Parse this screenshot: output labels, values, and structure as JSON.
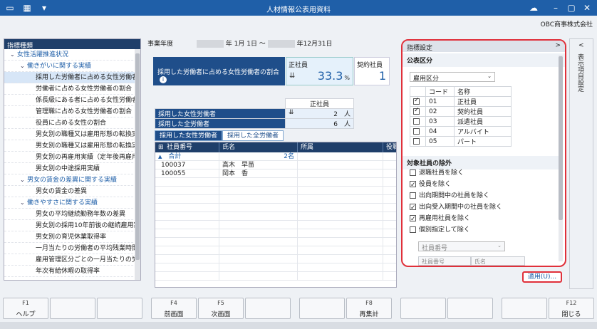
{
  "window": {
    "title": "人材情報公表用資料",
    "company": "OBC商事株式会社"
  },
  "tree": {
    "header": "指標種類",
    "items": [
      {
        "label": "女性活躍推進状況",
        "level": 0
      },
      {
        "label": "働きがいに関する実績",
        "level": 1
      },
      {
        "label": "採用した労働者に占める女性労働者の",
        "level": 2
      },
      {
        "label": "労働者に占める女性労働者の割合",
        "level": 2
      },
      {
        "label": "係長級にある者に占める女性労働者の",
        "level": 2
      },
      {
        "label": "管理職に占める女性労働者の割合",
        "level": 2
      },
      {
        "label": "役員に占める女性の割合",
        "level": 2
      },
      {
        "label": "男女別の職種又は雇用形態の転換実",
        "level": 2
      },
      {
        "label": "男女別の職種又は雇用形態の転換実",
        "level": 2
      },
      {
        "label": "男女別の再雇用実績（定年後再雇用",
        "level": 2
      },
      {
        "label": "男女別の中途採用実績",
        "level": 2
      },
      {
        "label": "男女の賃金の差異に関する実績",
        "level": 1
      },
      {
        "label": "男女の賃金の差異",
        "level": 2
      },
      {
        "label": "働きやすさに関する実績",
        "level": 1
      },
      {
        "label": "男女の平均継続勤務年数の差異",
        "level": 2
      },
      {
        "label": "男女別の採用10年前後の継続雇用割",
        "level": 2
      },
      {
        "label": "男女別の育児休業取得率",
        "level": 2
      },
      {
        "label": "一月当たりの労働者の平均残業時間",
        "level": 2
      },
      {
        "label": "雇用管理区分ごとの一月当たりの労",
        "level": 2
      },
      {
        "label": "年次有給休暇の取得率",
        "level": 2
      }
    ]
  },
  "period": {
    "label": "事業年度",
    "start_suffix": "年 1月 1日 ～",
    "end_suffix": "年12月31日"
  },
  "metric": {
    "title": "採用した労働者に占める女性労働者の割合",
    "info_icon": "i"
  },
  "cards": [
    {
      "label": "正社員",
      "value": "33.3",
      "unit": "%"
    },
    {
      "label": "契約社員",
      "value": "1"
    }
  ],
  "summary": {
    "column": "正社員",
    "rows": [
      {
        "label": "採用した女性労働者",
        "value": "2",
        "unit": "人"
      },
      {
        "label": "採用した全労働者",
        "value": "6",
        "unit": "人"
      }
    ]
  },
  "tabs": [
    {
      "label": "採用した女性労働者"
    },
    {
      "label": "採用した全労働者"
    }
  ],
  "grid": {
    "columns": [
      "社員番号",
      "氏名",
      "所属",
      "役職"
    ],
    "total_label": "合計",
    "total_count": "2名",
    "rows": [
      {
        "id": "100037",
        "name": "高木　早苗"
      },
      {
        "id": "100055",
        "name": "岡本　香"
      }
    ]
  },
  "settings": {
    "title": "指標設定",
    "chevron": ">",
    "section1": "公表区分",
    "category_select": "雇用区分",
    "code_header": "コード",
    "name_header": "名称",
    "codes": [
      {
        "code": "01",
        "name": "正社員",
        "checked": true
      },
      {
        "code": "02",
        "name": "契約社員",
        "checked": true
      },
      {
        "code": "03",
        "name": "派遣社員",
        "checked": false
      },
      {
        "code": "04",
        "name": "アルバイト",
        "checked": false
      },
      {
        "code": "05",
        "name": "パート",
        "checked": false
      }
    ],
    "section2": "対象社員の除外",
    "exclusions": [
      {
        "label": "退職社員を除く",
        "checked": false
      },
      {
        "label": "役員を除く",
        "checked": true
      },
      {
        "label": "出向期間中の社員を除く",
        "checked": false
      },
      {
        "label": "出向受入期間中の社員を除く",
        "checked": true
      },
      {
        "label": "再雇用社員を除く",
        "checked": true
      },
      {
        "label": "個別指定して除く",
        "checked": false
      }
    ],
    "emp_select": "社員番号",
    "emp_field1": "社員番号",
    "emp_field2": "氏名",
    "apply": "適用(U)..."
  },
  "side_pane": {
    "label": "表示項目設定",
    "chevron": "<"
  },
  "fkeys": [
    {
      "key": "F1",
      "label": "ヘルプ"
    },
    {
      "key": "",
      "label": ""
    },
    {
      "key": "",
      "label": ""
    },
    {
      "key": "F4",
      "label": "前画面"
    },
    {
      "key": "F5",
      "label": "次画面"
    },
    {
      "key": "",
      "label": ""
    },
    {
      "key": "",
      "label": ""
    },
    {
      "key": "F8",
      "label": "再集計"
    },
    {
      "key": "",
      "label": ""
    },
    {
      "key": "",
      "label": ""
    },
    {
      "key": "",
      "label": ""
    },
    {
      "key": "F12",
      "label": "閉じる"
    }
  ]
}
